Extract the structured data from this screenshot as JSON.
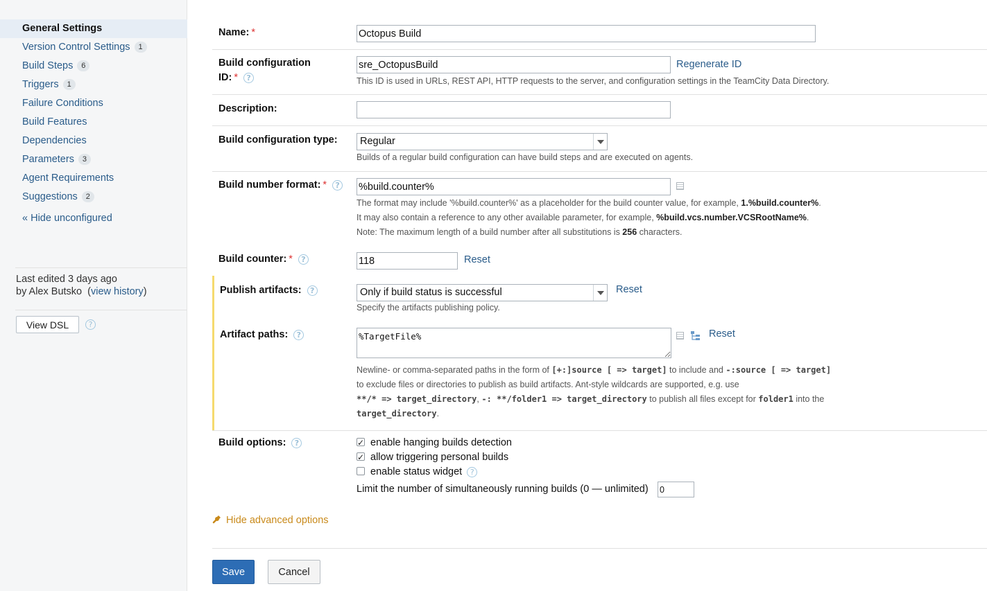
{
  "sidebar": {
    "items": [
      {
        "label": "General Settings",
        "count": null
      },
      {
        "label": "Version Control Settings",
        "count": "1"
      },
      {
        "label": "Build Steps",
        "count": "6"
      },
      {
        "label": "Triggers",
        "count": "1"
      },
      {
        "label": "Failure Conditions",
        "count": null
      },
      {
        "label": "Build Features",
        "count": null
      },
      {
        "label": "Dependencies",
        "count": null
      },
      {
        "label": "Parameters",
        "count": "3"
      },
      {
        "label": "Agent Requirements",
        "count": null
      },
      {
        "label": "Suggestions",
        "count": "2"
      }
    ],
    "hide_unconfigured": "« Hide unconfigured",
    "last_edited_line1": "Last edited 3 days ago",
    "last_edited_by": "by Alex Butsko",
    "view_history": "view history",
    "view_dsl": "View DSL"
  },
  "form": {
    "name": {
      "label": "Name:",
      "value": "Octopus Build"
    },
    "build_config_id": {
      "label_line1": "Build configuration",
      "label_line2": "ID:",
      "value": "sre_OctopusBuild",
      "regenerate": "Regenerate ID",
      "hint": "This ID is used in URLs, REST API, HTTP requests to the server, and configuration settings in the TeamCity Data Directory."
    },
    "description": {
      "label": "Description:",
      "value": ""
    },
    "build_config_type": {
      "label": "Build configuration type:",
      "value": "Regular",
      "hint": "Builds of a regular build configuration can have build steps and are executed on agents."
    },
    "build_number_format": {
      "label": "Build number format:",
      "value": "%build.counter%",
      "hint1_pre": "The format may include '%build.counter%' as a placeholder for the build counter value, for example, ",
      "hint1_bold": "1.%build.counter%",
      "hint1_post": ".",
      "hint2_pre": "It may also contain a reference to any other available parameter, for example, ",
      "hint2_bold": "%build.vcs.number.VCSRootName%",
      "hint2_post": ".",
      "hint3_pre": "Note: The maximum length of a build number after all substitutions is ",
      "hint3_bold": "256",
      "hint3_post": " characters."
    },
    "build_counter": {
      "label": "Build counter:",
      "value": "118",
      "reset": "Reset"
    },
    "publish_artifacts": {
      "label": "Publish artifacts:",
      "value": "Only if build status is successful",
      "reset": "Reset",
      "hint": "Specify the artifacts publishing policy."
    },
    "artifact_paths": {
      "label": "Artifact paths:",
      "value": "%TargetFile%",
      "reset": "Reset",
      "h1_a": "Newline- or comma-separated paths in the form of ",
      "h1_b": "[+:]source [ => target]",
      "h1_c": " to include and ",
      "h1_d": "-:source [ => target]",
      "h2": "to exclude files or directories to publish as build artifacts. Ant-style wildcards are supported, e.g. use",
      "h3_a": "**/* => target_directory",
      "h3_b": ", ",
      "h3_c": "-: **/folder1 => target_directory",
      "h3_d": " to publish all files except for ",
      "h3_e": "folder1",
      "h3_f": " into the",
      "h4_a": "target_directory",
      "h4_b": "."
    },
    "build_options": {
      "label": "Build options:",
      "opt1": "enable hanging builds detection",
      "opt2": "allow triggering personal builds",
      "opt3": "enable status widget",
      "limit_label": "Limit the number of simultaneously running builds (0 — unlimited)",
      "limit_value": "0"
    },
    "hide_advanced": "Hide advanced options",
    "save": "Save",
    "cancel": "Cancel"
  },
  "colors": {
    "accent": "#2d6db5",
    "link": "#2a5c8a",
    "required": "#dd3333",
    "advanced": "#c98a1b",
    "highlight_border": "#f5da6e"
  }
}
